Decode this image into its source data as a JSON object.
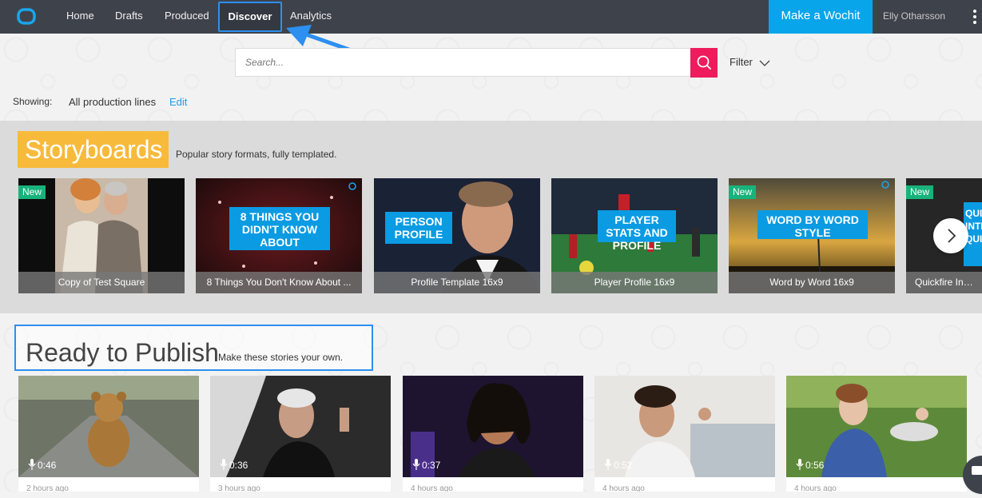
{
  "nav": {
    "items": [
      {
        "label": "Home"
      },
      {
        "label": "Drafts"
      },
      {
        "label": "Produced"
      },
      {
        "label": "Discover"
      },
      {
        "label": "Analytics"
      }
    ],
    "cta": "Make a Wochit",
    "user": "Elly Otharsson"
  },
  "search": {
    "placeholder": "Search...",
    "filter_label": "Filter"
  },
  "showing": {
    "label": "Showing:",
    "value": "All production lines",
    "edit": "Edit"
  },
  "storyboards": {
    "title": "Storyboards",
    "description": "Popular story formats, fully templated.",
    "new_badge": "New",
    "cards": [
      {
        "caption": "Copy of Test Square"
      },
      {
        "caption": "8 Things You Don't Know About ...",
        "overlay": "8 THINGS YOU DIDN'T KNOW ABOUT"
      },
      {
        "caption": "Profile Template 16x9",
        "overlay": "PERSON PROFILE"
      },
      {
        "caption": "Player Profile 16x9",
        "overlay": "PLAYER STATS AND PROFILE"
      },
      {
        "caption": "Word by Word 16x9",
        "overlay": "WORD BY WORD STYLE"
      },
      {
        "caption": "Quickfire Interv",
        "overlay": "QUI INTE QUI"
      }
    ]
  },
  "ready": {
    "title": "Ready to Publish",
    "description": "Make these stories your own.",
    "videos": [
      {
        "duration": "0:46",
        "age": "2 hours ago"
      },
      {
        "duration": "0:36",
        "age": "3 hours ago"
      },
      {
        "duration": "0:37",
        "age": "4 hours ago"
      },
      {
        "duration": "0:52",
        "age": "4 hours ago"
      },
      {
        "duration": "0:56",
        "age": "4 hours ago"
      }
    ]
  }
}
